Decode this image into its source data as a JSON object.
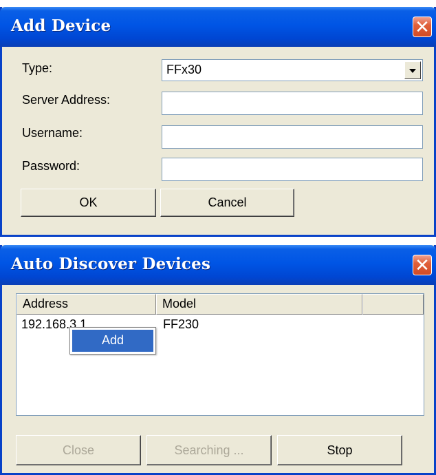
{
  "add_device": {
    "title": "Add Device",
    "close_glyph": "✕",
    "type_label": "Type:",
    "type_value": "FFx30",
    "server_label": "Server Address:",
    "server_value": "",
    "username_label": "Username:",
    "username_value": "",
    "password_label": "Password:",
    "password_value": "",
    "ok_label": "OK",
    "cancel_label": "Cancel"
  },
  "auto_discover": {
    "title": "Auto Discover Devices",
    "close_glyph": "✕",
    "columns": [
      "Address",
      "Model",
      ""
    ],
    "rows": [
      {
        "address": "192.168.3.1",
        "model": "FF230"
      }
    ],
    "context_menu": {
      "item": "Add"
    },
    "close_label": "Close",
    "searching_label": "Searching ...",
    "stop_label": "Stop"
  },
  "colors": {
    "titlebar": "#0055e5",
    "window_bg": "#ece9d8",
    "selection": "#316ac5",
    "close_button": "#d34b26"
  },
  "icons": {
    "close": "close-icon",
    "dropdown": "chevron-down-icon"
  }
}
